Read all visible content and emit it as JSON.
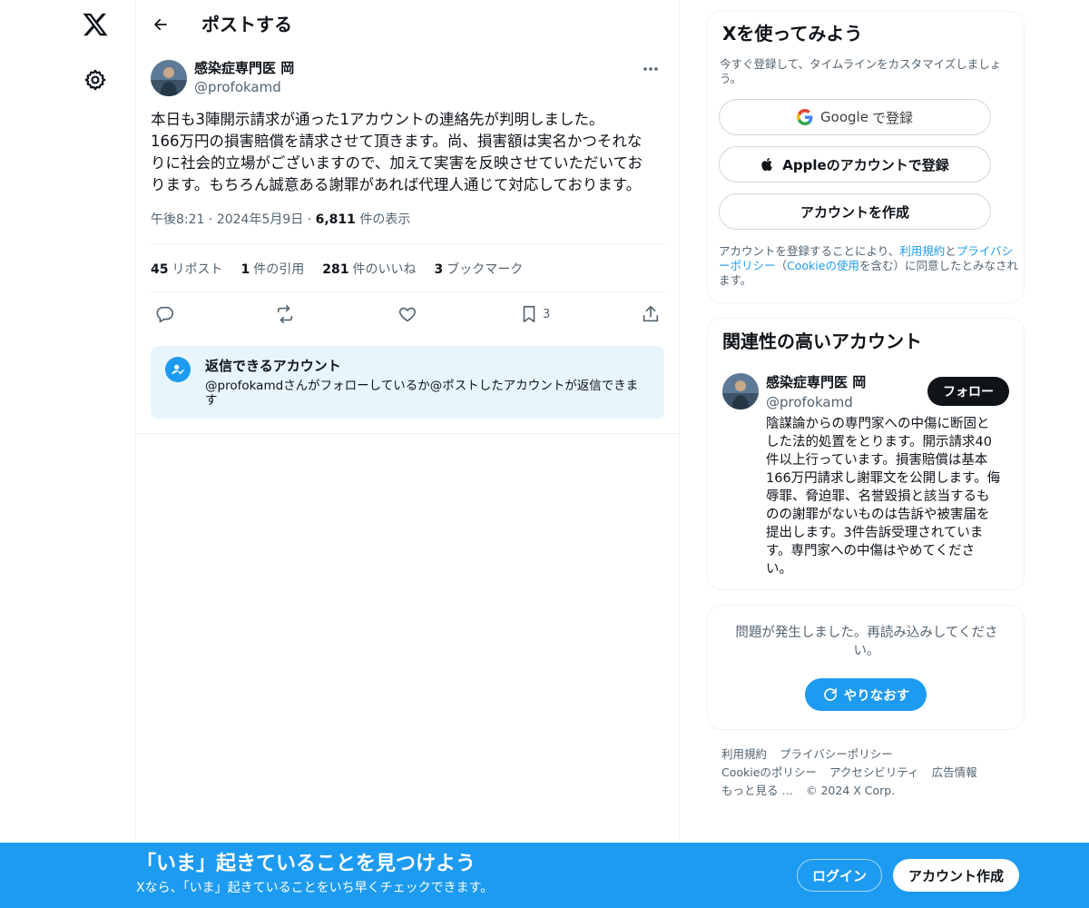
{
  "nav": {
    "logo_icon": "x-logo-icon",
    "settings_icon": "gear-icon"
  },
  "header": {
    "title": "ポストする",
    "back_icon": "arrow-left-icon"
  },
  "post": {
    "author_name": "感染症専門医 岡",
    "author_handle": "@profokamd",
    "text_lines": [
      "本日も3陣開示請求が通った1アカウントの連絡先が判明しました。",
      "166万円の損害賠償を請求させて頂きます。尚、損害額は実名かつそれな",
      "りに社会的立場がございますので、加えて実害を反映させていただいてお",
      "ります。もちろん誠意ある謝罪があれば代理人通じて対応しております。"
    ],
    "time": "午後8:21",
    "date": "2024年5月9日",
    "views_count": "6,811",
    "views_label": "件の表示",
    "sep": "·",
    "stats": {
      "reposts_count": "45",
      "reposts_label": "リポスト",
      "quotes_count": "1",
      "quotes_label": "件の引用",
      "likes_count": "281",
      "likes_label": "件のいいね",
      "bookmarks_count": "3",
      "bookmarks_label": "ブックマーク"
    },
    "actions": {
      "bookmark_count": "3"
    },
    "reply_restriction": {
      "title": "返信できるアカウント",
      "description": "@profokamdさんがフォローしているか@ポストしたアカウントが返信できます"
    }
  },
  "signup_card": {
    "title": "Xを使ってみよう",
    "subtitle": "今すぐ登録して、タイムラインをカスタマイズしましょう。",
    "google_label": "Google",
    "google_suffix": "で登録",
    "apple_label": "Appleのアカウントで登録",
    "create_label": "アカウントを作成",
    "terms_prefix": "アカウントを登録することにより、",
    "terms_link": "利用規約",
    "terms_and": "と",
    "privacy_link": "プライバシーポリシー",
    "terms_open": "（",
    "cookie_link": "Cookieの使用",
    "terms_suffix": "を含む）に同意したとみなされます。"
  },
  "relevant": {
    "title": "関連性の高いアカウント",
    "name": "感染症専門医 岡",
    "handle": "@profokamd",
    "follow_label": "フォロー",
    "bio_lines": [
      "陰謀論からの専門家への中傷に断固と",
      "した法的処置をとります。開示請求40",
      "件以上行っています。損害賠償は基本",
      "166万円請求し謝罪文を公開します。侮",
      "辱罪、脅迫罪、名誉毀損と該当するも",
      "のの謝罪がないものは告訴や被害届を",
      "提出します。3件告訴受理されていま",
      "す。専門家への中傷はやめてくださ",
      "い。"
    ]
  },
  "error_card": {
    "message": "問題が発生しました。再読み込みしてください。",
    "retry_label": "やりなおす"
  },
  "footer": {
    "terms": "利用規約",
    "privacy": "プライバシーポリシー",
    "cookie": "Cookieのポリシー",
    "accessibility": "アクセシビリティ",
    "ads": "広告情報",
    "more": "もっと見る …",
    "copyright": "© 2024 X Corp."
  },
  "banner": {
    "title": "「いま」起きていることを見つけよう",
    "subtitle": "Xなら、「いま」起きていることをいち早くチェックできます。",
    "login_label": "ログイン",
    "signup_label": "アカウント作成"
  },
  "colors": {
    "accent": "#1d9bf0",
    "text": "#0f1419",
    "muted": "#536471",
    "border": "#eff3f4"
  }
}
